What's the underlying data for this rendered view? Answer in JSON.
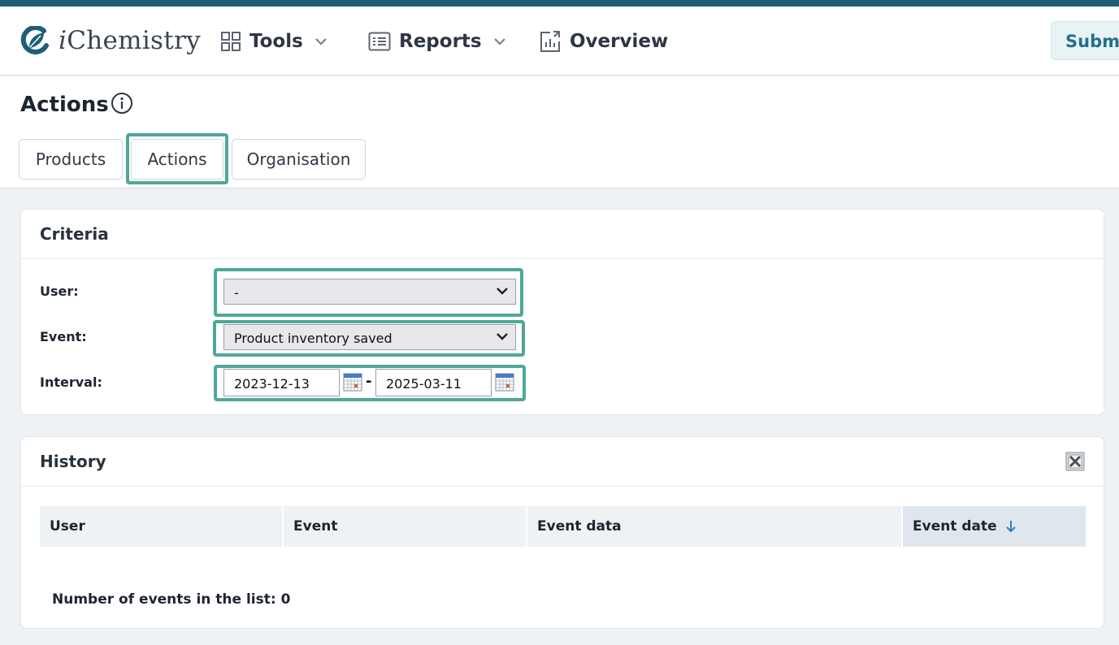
{
  "brand": {
    "prefix": "i",
    "name": "Chemistry"
  },
  "nav": {
    "tools": "Tools",
    "reports": "Reports",
    "overview": "Overview",
    "submit": "Submit"
  },
  "page": {
    "title": "Actions"
  },
  "tabs": [
    {
      "label": "Products"
    },
    {
      "label": "Actions",
      "active": true
    },
    {
      "label": "Organisation"
    }
  ],
  "criteria": {
    "title": "Criteria",
    "user_label": "User:",
    "user_value": "-",
    "event_label": "Event:",
    "event_value": "Product inventory saved",
    "interval_label": "Interval:",
    "date_from": "2023-12-13",
    "separator": "-",
    "date_to": "2025-03-11"
  },
  "history": {
    "title": "History",
    "columns": [
      "User",
      "Event",
      "Event data",
      "Event date"
    ],
    "sorted_column": "Event date",
    "sort_direction": "descending",
    "count_text": "Number of events in the list: 0"
  },
  "colors": {
    "accent_stripe": "#1f5d78",
    "highlight": "#4ea89a",
    "link": "#1f6f8b"
  }
}
